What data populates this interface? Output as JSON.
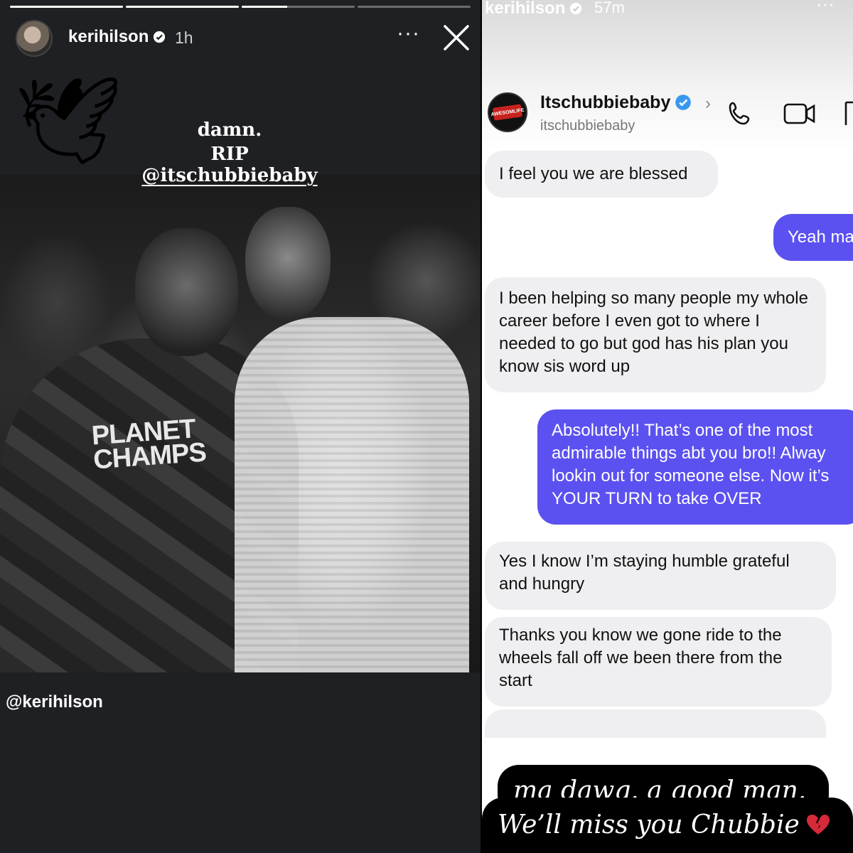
{
  "left_story": {
    "username": "kerihilson",
    "time": "1h",
    "more": "···",
    "progress": [
      1,
      1,
      0.4,
      0
    ],
    "caption_line1": "damn.",
    "caption_line2_prefix": "RIP ",
    "caption_mention": "@itschubbiebaby",
    "shirt_text": "PLANET\nCHAMPS",
    "footer_mention": "@kerihilson",
    "sticker_icon": "dove-with-olive-branch"
  },
  "right_story": {
    "username": "kerihilson",
    "time": "57m",
    "more": "···",
    "dm": {
      "name": "Itschubbiebaby",
      "handle": "itschubbiebaby",
      "avatar_text": "AWESOMLIFE",
      "messages": [
        {
          "from": "them",
          "text": "I feel you we are blessed"
        },
        {
          "from": "me",
          "text": "Yeah ma"
        },
        {
          "from": "them",
          "text": "I been helping so many people my whole career before I even got to where I needed to go but god has his plan you know sis word up"
        },
        {
          "from": "me",
          "text": "Absolutely!! That’s one of the most\nadmirable things abt you bro!! Alway\nlookin out for someone else. Now it’s\nYOUR TURN to take OVER"
        },
        {
          "from": "them",
          "text": "Yes I know I’m staying humble grateful and hungry"
        },
        {
          "from": "them",
          "text": "Thanks you know we gone ride to the wheels fall off we been there from the start"
        }
      ]
    },
    "overlay_line1": "ma dawg. a good man.",
    "overlay_line2": "We’ll miss you Chubbie",
    "heart_icon": "broken-heart-icon",
    "accent_color": "#5b51f0"
  }
}
